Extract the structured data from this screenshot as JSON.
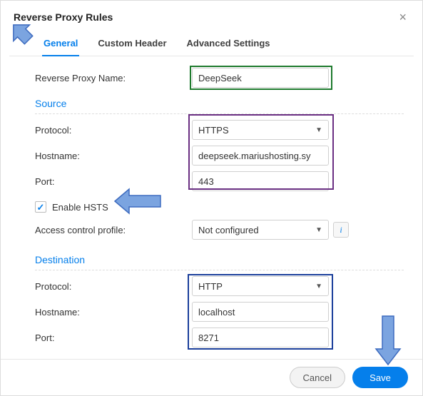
{
  "dialog": {
    "title": "Reverse Proxy Rules"
  },
  "tabs": {
    "general": "General",
    "custom_header": "Custom Header",
    "advanced": "Advanced Settings"
  },
  "fields": {
    "name_label": "Reverse Proxy Name:",
    "name_value": "DeepSeek",
    "source_title": "Source",
    "protocol_label": "Protocol:",
    "hostname_label": "Hostname:",
    "port_label": "Port:",
    "src_protocol": "HTTPS",
    "src_hostname": "deepseek.mariushosting.sy",
    "src_port": "443",
    "enable_hsts": "Enable HSTS",
    "acp_label": "Access control profile:",
    "acp_value": "Not configured",
    "dest_title": "Destination",
    "dst_protocol": "HTTP",
    "dst_hostname": "localhost",
    "dst_port": "8271"
  },
  "footer": {
    "cancel": "Cancel",
    "save": "Save"
  }
}
